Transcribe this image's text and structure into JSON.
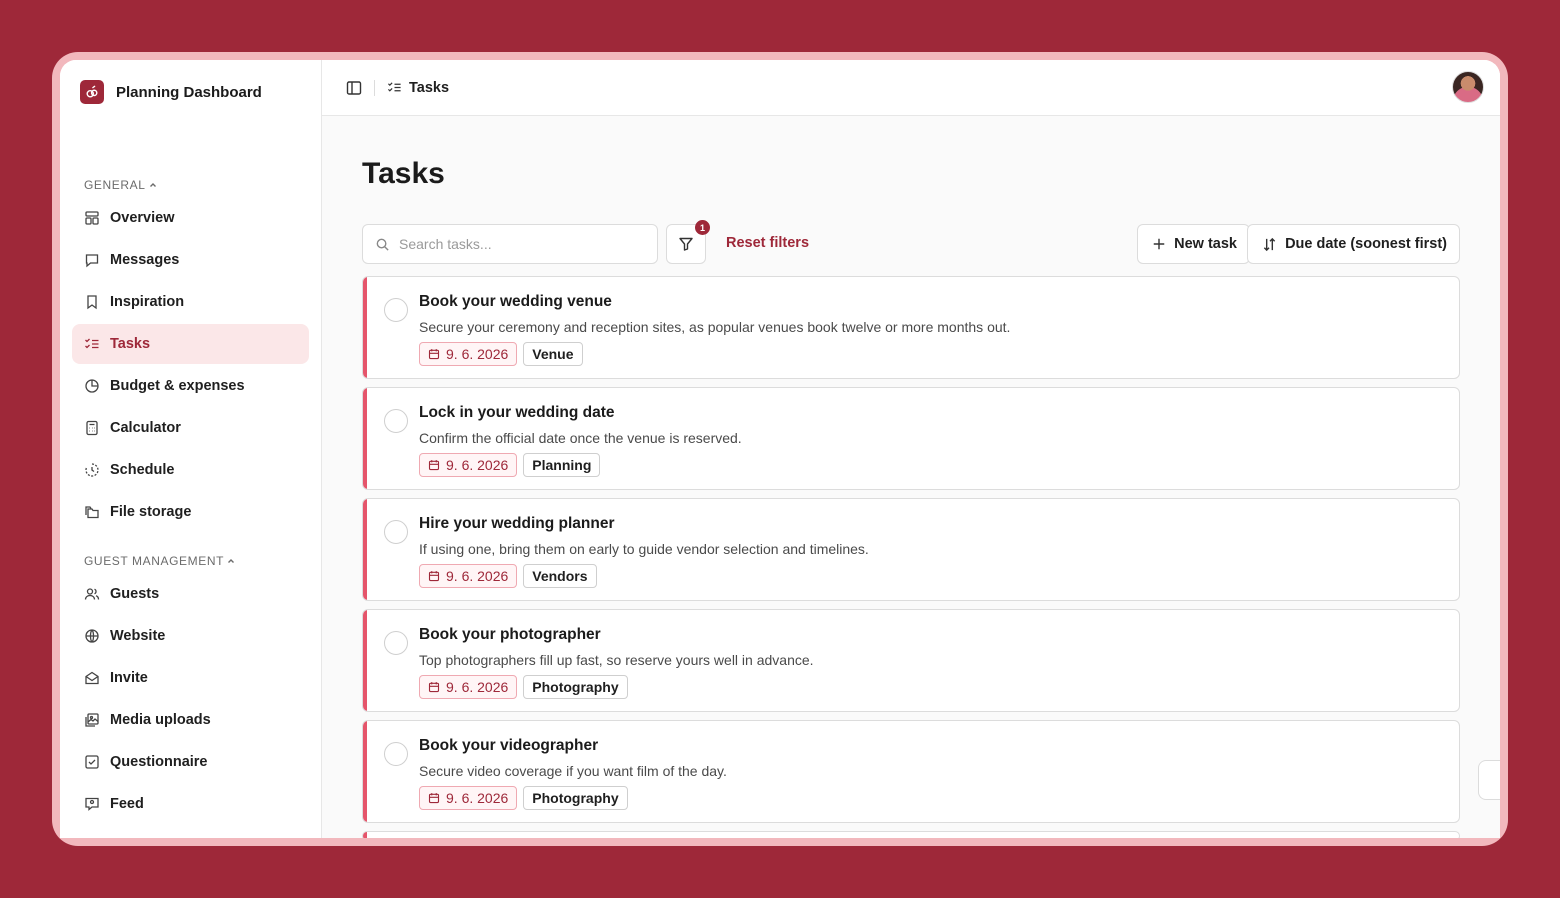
{
  "brand": {
    "name": "Planning Dashboard"
  },
  "sidebar": {
    "sections": [
      {
        "label": "GENERAL",
        "items": [
          {
            "label": "Overview",
            "icon": "layout-icon"
          },
          {
            "label": "Messages",
            "icon": "message-icon"
          },
          {
            "label": "Inspiration",
            "icon": "bookmark-icon"
          },
          {
            "label": "Tasks",
            "icon": "checklist-icon",
            "active": true
          },
          {
            "label": "Budget & expenses",
            "icon": "pie-chart-icon"
          },
          {
            "label": "Calculator",
            "icon": "calculator-icon"
          },
          {
            "label": "Schedule",
            "icon": "clock-icon"
          },
          {
            "label": "File storage",
            "icon": "folders-icon"
          }
        ]
      },
      {
        "label": "GUEST MANAGEMENT",
        "items": [
          {
            "label": "Guests",
            "icon": "users-icon"
          },
          {
            "label": "Website",
            "icon": "globe-icon"
          },
          {
            "label": "Invite",
            "icon": "envelope-icon"
          },
          {
            "label": "Media uploads",
            "icon": "images-icon"
          },
          {
            "label": "Questionnaire",
            "icon": "checkbox-icon"
          },
          {
            "label": "Feed",
            "icon": "feed-icon"
          }
        ]
      }
    ]
  },
  "topbar": {
    "breadcrumb": "Tasks"
  },
  "main": {
    "title": "Tasks",
    "search_placeholder": "Search tasks...",
    "filter_count": "1",
    "reset_label": "Reset filters",
    "new_task_label": "New task",
    "sort_label": "Due date (soonest first)"
  },
  "tasks": [
    {
      "title": "Book your wedding venue",
      "description": "Secure your ceremony and reception sites, as popular venues book twelve or more months out.",
      "date": "9. 6. 2026",
      "category": "Venue"
    },
    {
      "title": "Lock in your wedding date",
      "description": "Confirm the official date once the venue is reserved.",
      "date": "9. 6. 2026",
      "category": "Planning"
    },
    {
      "title": "Hire your wedding planner",
      "description": "If using one, bring them on early to guide vendor selection and timelines.",
      "date": "9. 6. 2026",
      "category": "Vendors"
    },
    {
      "title": "Book your photographer",
      "description": "Top photographers fill up fast, so reserve yours well in advance.",
      "date": "9. 6. 2026",
      "category": "Photography"
    },
    {
      "title": "Book your videographer",
      "description": "Secure video coverage if you want film of the day.",
      "date": "9. 6. 2026",
      "category": "Photography"
    }
  ],
  "colors": {
    "brand": "#9e2839",
    "accent_stripe": "#e5556b",
    "active_bg": "#fbe7e8"
  }
}
